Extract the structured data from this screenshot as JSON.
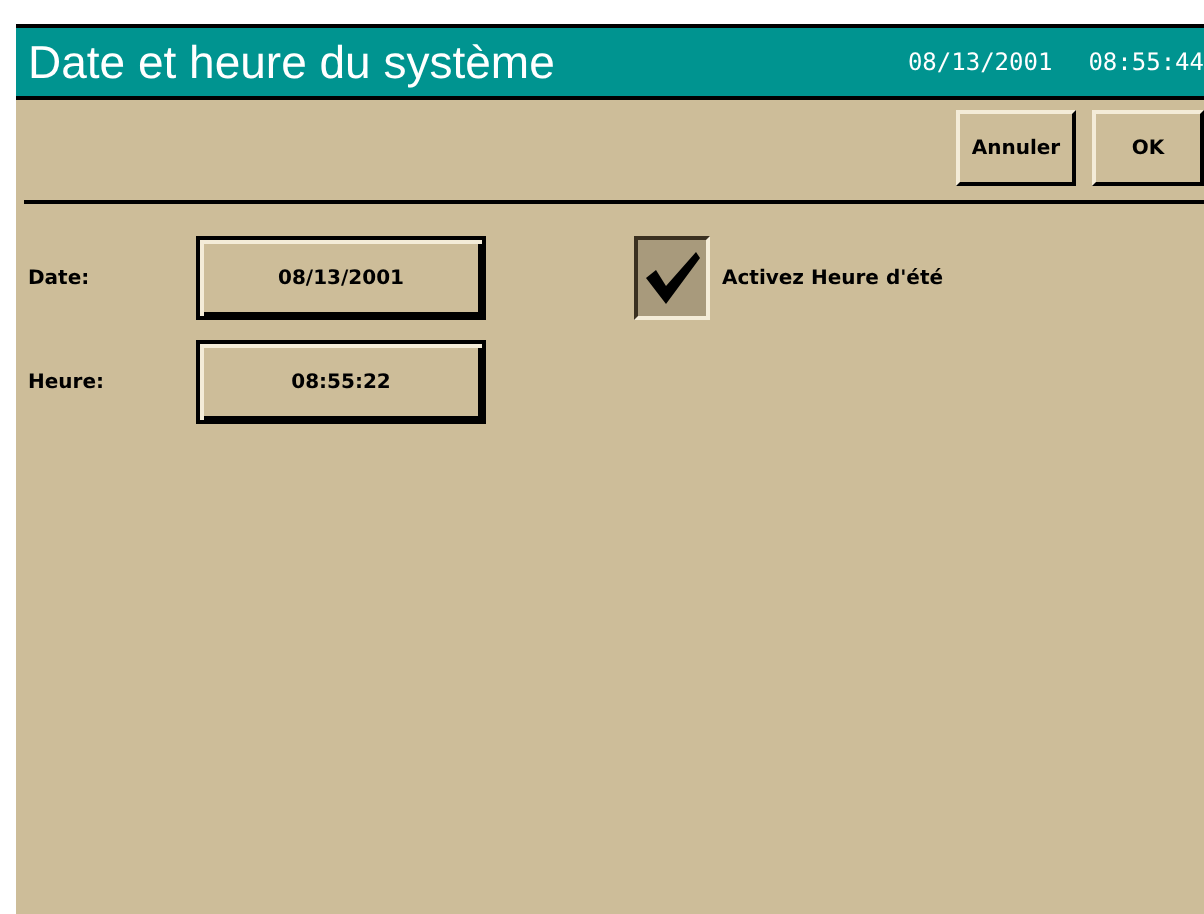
{
  "window": {
    "title": "Date et heure du système",
    "date": "08/13/2001",
    "time": "08:55:44"
  },
  "buttons": [
    "Annuler",
    "OK"
  ],
  "fields": [
    {
      "label": "Date:",
      "value": "08/13/2001"
    },
    {
      "label": "Heure:",
      "value": "08:55:22"
    }
  ],
  "dst": {
    "label": "Activez Heure d'été",
    "checked": true
  }
}
